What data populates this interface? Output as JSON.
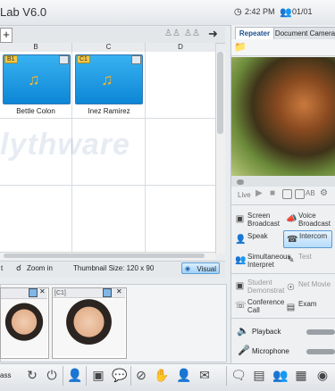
{
  "app": {
    "title": "Lab V6.0",
    "time": "2:42 PM",
    "user_count": "01/01"
  },
  "grid": {
    "plus_label": "+",
    "columns": [
      "B",
      "C",
      "D"
    ],
    "tiles": [
      {
        "tag": "B1",
        "name": "Bettle Colon"
      },
      {
        "tag": "C1",
        "name": "Inez Ramirez"
      }
    ],
    "watermark": "lythware",
    "status": {
      "left_fragment": "t",
      "zoom_label": "Zoom in",
      "thumb_size": "Thumbnail Size: 120 x 90",
      "visual_label": "Visual"
    }
  },
  "photos": [
    {
      "tag": ""
    },
    {
      "tag": "[C1]"
    }
  ],
  "right": {
    "tabs": [
      "Repeater",
      "Document Camera"
    ],
    "video_controls_label": "Live",
    "buttons": [
      {
        "label": "Screen Broadcast",
        "icon": "screen-broadcast-icon",
        "state": "normal"
      },
      {
        "label": "Voice Broadcast",
        "icon": "voice-broadcast-icon",
        "state": "normal"
      },
      {
        "label": "Speak",
        "icon": "speak-icon",
        "state": "normal"
      },
      {
        "label": "Intercom",
        "icon": "intercom-icon",
        "state": "selected"
      },
      {
        "label": "Simultaneous Interpret",
        "icon": "interpret-icon",
        "state": "normal"
      },
      {
        "label": "Test",
        "icon": "test-icon",
        "state": "disabled"
      },
      {
        "label": "Student Demonstrat",
        "icon": "student-demo-icon",
        "state": "disabled"
      },
      {
        "label": "Net Movie",
        "icon": "net-movie-icon",
        "state": "disabled"
      },
      {
        "label": "Conference Call",
        "icon": "conference-icon",
        "state": "normal"
      },
      {
        "label": "Exam",
        "icon": "exam-icon",
        "state": "normal"
      }
    ],
    "audio": [
      {
        "label": "Playback"
      },
      {
        "label": "Microphone"
      }
    ]
  },
  "bottom": {
    "left_fragment": "ass"
  }
}
